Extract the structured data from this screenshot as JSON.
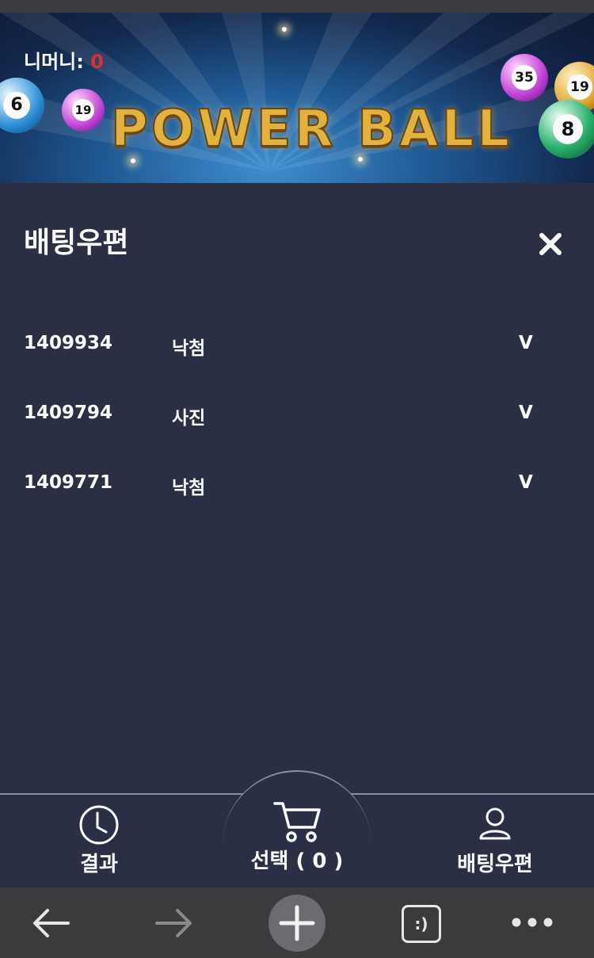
{
  "header": {
    "money_label": "니머니:",
    "money_value": "0",
    "logo_text": "POWER BALL",
    "balls": [
      "6",
      "19",
      "35",
      "19",
      "8"
    ]
  },
  "panel": {
    "title": "배팅우편",
    "close_icon": "close-icon",
    "rows": [
      {
        "id": "1409934",
        "status": "낙첨",
        "check": "V"
      },
      {
        "id": "1409794",
        "status": "사진",
        "check": "V"
      },
      {
        "id": "1409771",
        "status": "낙첨",
        "check": "V"
      }
    ]
  },
  "bottom_nav": {
    "left_label": "결과",
    "center_label": "선택 ( 0 )",
    "right_label": "배팅우편"
  },
  "browser_bar": {
    "back_icon": "arrow-left-icon",
    "forward_icon": "arrow-right-icon",
    "new_tab_icon": "plus-icon",
    "tabs_label": ":)",
    "more_icon": "more-dots-icon"
  },
  "colors": {
    "background": "#2b2f44",
    "money_value": "#e0302b",
    "logo_gold": "#e2b23a",
    "browser_bar": "#3b3b3e"
  }
}
